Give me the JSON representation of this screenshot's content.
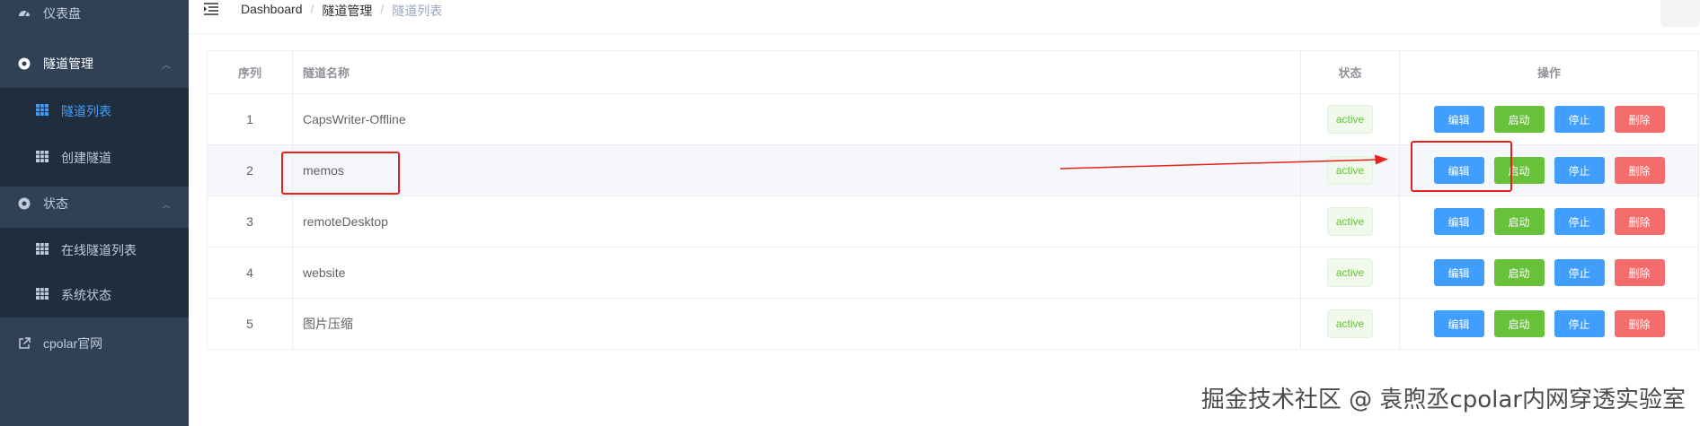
{
  "sidebar": {
    "items": [
      {
        "label": "仪表盘",
        "icon": "dashboard-icon"
      },
      {
        "label": "隧道管理",
        "icon": "tunnel-icon",
        "expanded": true,
        "children": [
          {
            "label": "隧道列表",
            "icon": "table-grid-icon",
            "active": true
          },
          {
            "label": "创建隧道",
            "icon": "table-grid-icon"
          }
        ]
      },
      {
        "label": "状态",
        "icon": "status-icon",
        "expanded": true,
        "children": [
          {
            "label": "在线隧道列表",
            "icon": "table-grid-icon"
          },
          {
            "label": "系统状态",
            "icon": "table-grid-icon"
          }
        ]
      },
      {
        "label": "cpolar官网",
        "icon": "external-link-icon"
      }
    ]
  },
  "breadcrumb": [
    "Dashboard",
    "隧道管理",
    "隧道列表"
  ],
  "table": {
    "headers": [
      "序列",
      "隧道名称",
      "状态",
      "操作"
    ],
    "actions": [
      "编辑",
      "启动",
      "停止",
      "删除"
    ],
    "rows": [
      {
        "index": "1",
        "name": "CapsWriter-Offline",
        "status": "active"
      },
      {
        "index": "2",
        "name": "memos",
        "status": "active"
      },
      {
        "index": "3",
        "name": "remoteDesktop",
        "status": "active"
      },
      {
        "index": "4",
        "name": "website",
        "status": "active"
      },
      {
        "index": "5",
        "name": "图片压缩",
        "status": "active"
      }
    ]
  },
  "watermark": "掘金技术社区 @ 袁煦丞cpolar内网穿透实验室",
  "colors": {
    "sidebar": "#304156",
    "submenu": "#1f2d3d",
    "accent": "#409eff",
    "success": "#67c23a",
    "danger": "#f56c6c",
    "annotation": "#e8221b"
  }
}
